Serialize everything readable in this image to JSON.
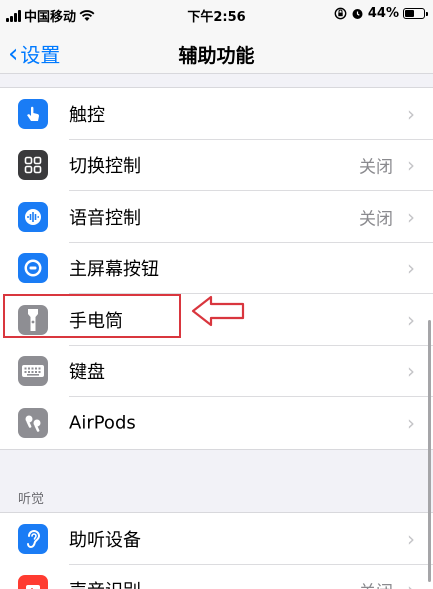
{
  "status_bar": {
    "carrier": "中国移动",
    "time": "下午2:56",
    "battery": "44%"
  },
  "nav": {
    "back_label": "设置",
    "title": "辅助功能"
  },
  "group1": [
    {
      "label": "触控",
      "value": "",
      "icon": "touch-hand-icon",
      "color": "#1a7cf5"
    },
    {
      "label": "切换控制",
      "value": "关闭",
      "icon": "switch-control-icon",
      "color": "#3a3a3c"
    },
    {
      "label": "语音控制",
      "value": "关闭",
      "icon": "voice-control-icon",
      "color": "#1a7cf5"
    },
    {
      "label": "主屏幕按钮",
      "value": "",
      "icon": "home-button-icon",
      "color": "#1a7cf5"
    },
    {
      "label": "手电筒",
      "value": "",
      "icon": "flashlight-icon",
      "color": "#8e8e93"
    },
    {
      "label": "键盘",
      "value": "",
      "icon": "keyboard-icon",
      "color": "#8e8e93"
    },
    {
      "label": "AirPods",
      "value": "",
      "icon": "airpods-icon",
      "color": "#8e8e93"
    }
  ],
  "section_hearing": {
    "header": "听觉"
  },
  "group2": [
    {
      "label": "助听设备",
      "value": "",
      "icon": "hearing-aid-icon",
      "color": "#1a7cf5"
    },
    {
      "label": "声音识别",
      "value": "关闭",
      "icon": "sound-recognition-icon",
      "color": "#ff3b30"
    }
  ]
}
